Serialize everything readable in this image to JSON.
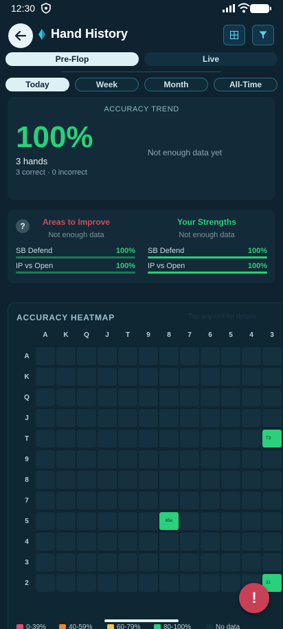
{
  "status": {
    "time": "12:30"
  },
  "header": {
    "title": "Hand History"
  },
  "tabs": [
    {
      "label": "Pre-Flop",
      "active": true
    },
    {
      "label": "Live",
      "active": false
    }
  ],
  "periods": [
    {
      "label": "Today",
      "active": true
    },
    {
      "label": "Week",
      "active": false
    },
    {
      "label": "Month",
      "active": false
    },
    {
      "label": "All-Time",
      "active": false
    }
  ],
  "accuracy": {
    "label": "ACCURACY TREND",
    "percent": "100%",
    "hands": "3 hands",
    "breakdown": "3 correct · 0 incorrect",
    "empty_text": "Not enough data yet"
  },
  "insights": {
    "help": "?",
    "improve": {
      "title": "Areas to Improve",
      "subtitle": "Not enough data",
      "color": "#c84e60"
    },
    "strengths": {
      "title": "Your Strengths",
      "subtitle": "Not enough data",
      "color": "#2ad07a"
    },
    "improve_rows": [
      {
        "label": "SB Defend",
        "pct": "100%",
        "fill": 1.0
      },
      {
        "label": "IP vs Open",
        "pct": "100%",
        "fill": 1.0
      }
    ],
    "strength_rows": [
      {
        "label": "SB Defend",
        "pct": "100%",
        "fill": 1.0
      },
      {
        "label": "IP vs Open",
        "pct": "100%",
        "fill": 1.0
      }
    ]
  },
  "heatmap": {
    "title": "ACCURACY HEATMAP",
    "hint": "Tap any cell for details",
    "columns": [
      "A",
      "K",
      "Q",
      "J",
      "T",
      "9",
      "8",
      "7",
      "6",
      "5",
      "4",
      "3"
    ],
    "rows": [
      "A",
      "K",
      "Q",
      "J",
      "T",
      "9",
      "8",
      "7",
      "5",
      "4",
      "3",
      "2"
    ],
    "hit_cells": [
      {
        "row": "5",
        "col": "8",
        "label": "85o"
      },
      {
        "row": "T",
        "col": "3",
        "label": "T3"
      },
      {
        "row": "2",
        "col": "3",
        "label": "32"
      }
    ]
  },
  "legend": [
    {
      "label": "0-39%",
      "color": "#e0506a"
    },
    {
      "label": "40-59%",
      "color": "#f0842c"
    },
    {
      "label": "60-79%",
      "color": "#f2c254"
    },
    {
      "label": "80-100%",
      "color": "#2ad07a"
    },
    {
      "label": "No data",
      "color": "#15303e"
    }
  ],
  "colors": {
    "accent_green": "#2ad07a",
    "background": "#0e2230",
    "card": "#132b39"
  },
  "fab": {
    "label": "!"
  }
}
